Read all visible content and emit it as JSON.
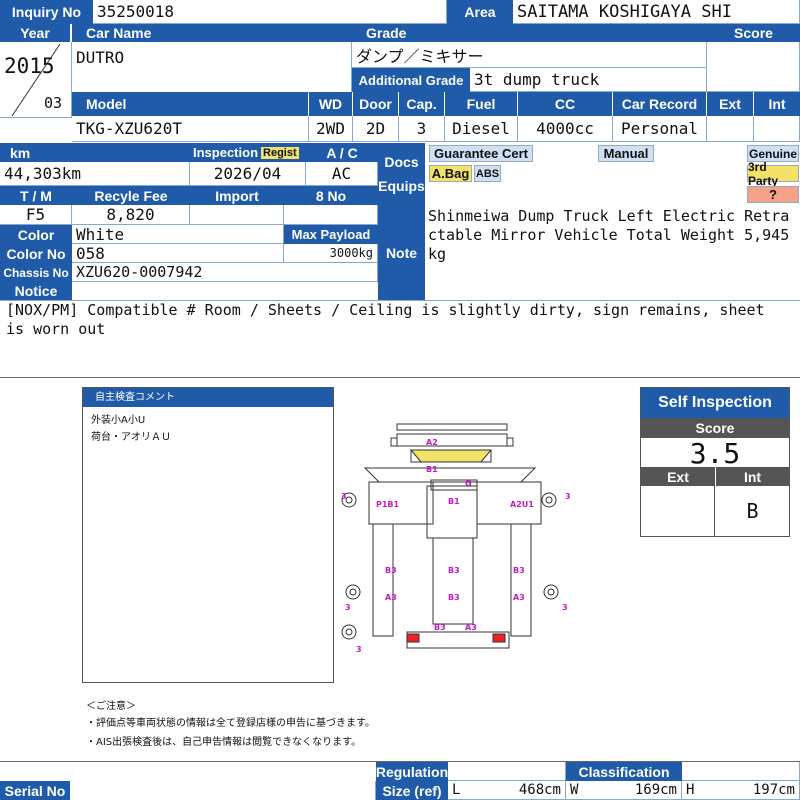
{
  "labels": {
    "inquiry_no": "Inquiry No",
    "area": "Area",
    "year": "Year",
    "car_name": "Car Name",
    "grade": "Grade",
    "score": "Score",
    "additional_grade": "Additional Grade",
    "model": "Model",
    "wd": "WD",
    "door": "Door",
    "cap": "Cap.",
    "fuel": "Fuel",
    "cc": "CC",
    "car_record": "Car Record",
    "ext": "Ext",
    "int": "Int",
    "km": "km",
    "inspection": "Inspection",
    "regist": "Regist",
    "ac": "A / C",
    "docs": "Docs",
    "equips": "Equips",
    "tm": "T / M",
    "recycle_fee": "Recyle Fee",
    "import": "Import",
    "no8": "8 No",
    "color": "Color",
    "max_payload": "Max Payload",
    "color_no": "Color No",
    "note": "Note",
    "chassis_no": "Chassis No",
    "notice": "Notice",
    "serial_no": "Serial No",
    "regulation": "Regulation",
    "size_ref": "Size (ref)",
    "classification": "Classification",
    "l": "L",
    "w": "W",
    "h": "H"
  },
  "vehicle": {
    "inquiry_no": "35250018",
    "area": "SAITAMA KOSHIGAYA SHI",
    "year": "2015",
    "month": "03",
    "car_name": "DUTRO",
    "grade": "ダンプ／ミキサー",
    "additional_grade": "3t dump truck",
    "model": "TKG-XZU620T",
    "wd": "2WD",
    "door": "2D",
    "cap": "3",
    "fuel": "Diesel",
    "cc": "4000cc",
    "car_record": "Personal",
    "km": "44,303km",
    "inspection": "2026/04",
    "ac": "AC",
    "tm": "F5",
    "recycle_fee": "8,820",
    "color": "White",
    "max_payload": "3000kg",
    "color_no": "058",
    "chassis_no": "XZU620-0007942",
    "note": "Shinmeiwa Dump Truck Left Electric Retractable Mirror Vehicle Total Weight 5,945kg",
    "notice": "[NOX/PM] Compatible # Room / Sheets / Ceiling is slightly dirty, sign remains, sheet is worn out",
    "size_l": "468cm",
    "size_w": "169cm",
    "size_h": "197cm"
  },
  "equips": {
    "guarantee_cert": "Guarantee Cert",
    "manual": "Manual",
    "abag": "A.Bag",
    "abs": "ABS",
    "genuine": "Genuine",
    "third_party": "3rd Party",
    "unknown": "?"
  },
  "inspection_comment": {
    "title": "自主検査コメント",
    "lines": [
      "外装小A小U",
      "荷台・アオリＡＵ"
    ]
  },
  "caution": {
    "title": "＜ご注意＞",
    "lines": [
      "・評価点等車両状態の情報は全て登録店様の申告に基づきます。",
      "・AIS出張検査後は、自己申告情報は閲覧できなくなります。"
    ]
  },
  "self_inspection": {
    "title": "Self Inspection",
    "score_label": "Score",
    "score": "3.5",
    "ext_label": "Ext",
    "int_label": "Int",
    "ext": "",
    "int": "B"
  },
  "damage_labels": {
    "a2": "A2",
    "b1_top": "B1",
    "g": "G",
    "p1b1": "P1B1",
    "b1_mid": "B1",
    "a2u1": "A2U1",
    "b3_l": "B3",
    "a3_l": "A3",
    "b3_c1": "B3",
    "b3_c2": "B3",
    "b3_r": "B3",
    "a3_r": "A3",
    "b3_bot": "B3",
    "a3_bot": "A3",
    "t3_l": "3",
    "t3_r": "3",
    "t3_bl": "3",
    "t3_br": "3",
    "t3_sp": "3"
  },
  "colors": {
    "header_blue": "#1f5ba8",
    "tag_blue": "#cfe0f5",
    "tag_yellow": "#f3e26a",
    "tag_red": "#f4a28a",
    "damage_pink": "#c21cc2"
  }
}
